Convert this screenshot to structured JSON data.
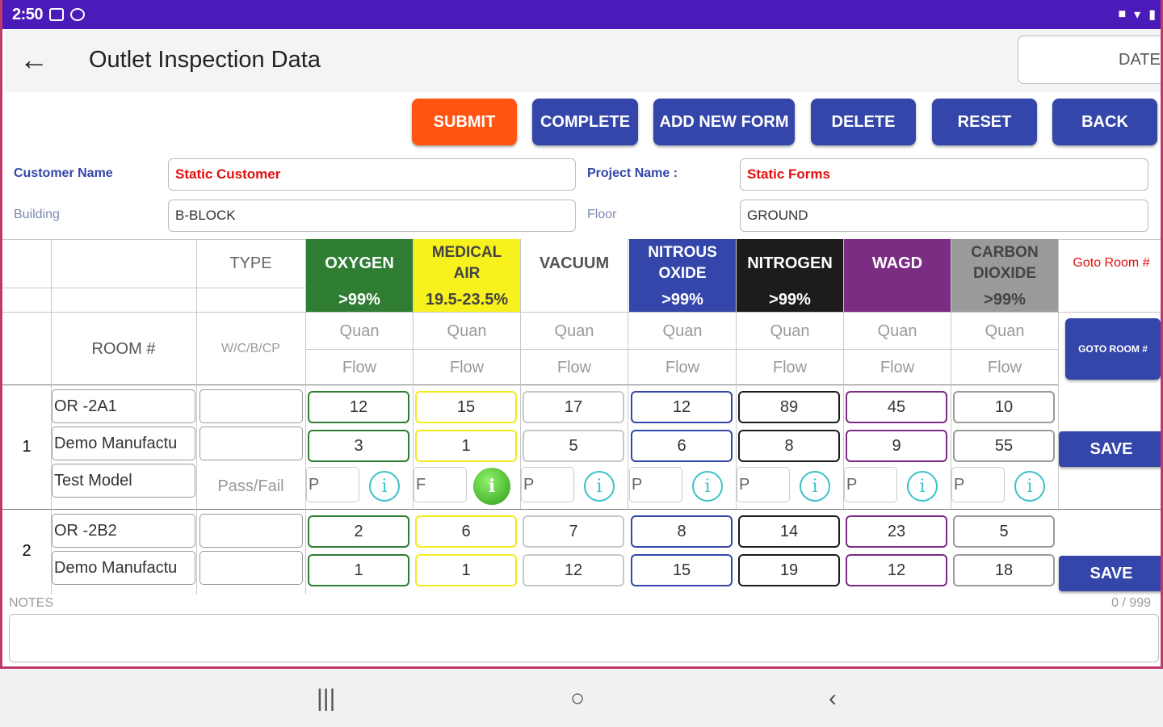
{
  "status": {
    "time": "2:50"
  },
  "appbar": {
    "title": "Outlet Inspection Data",
    "date_placeholder": "DATE"
  },
  "toolbar": {
    "submit": "SUBMIT",
    "complete": "COMPLETE",
    "add_new_form": "ADD NEW FORM",
    "delete": "DELETE",
    "reset": "RESET",
    "back": "BACK"
  },
  "form": {
    "customer_label": "Customer Name",
    "customer_value": "Static Customer",
    "project_label": "Project Name :",
    "project_value": "Static Forms",
    "building_label": "Building",
    "building_value": "B-BLOCK",
    "floor_label": "Floor",
    "floor_value": "GROUND"
  },
  "table": {
    "type_header": "TYPE",
    "room_header": "ROOM #",
    "type_sub": "W/C/B/CP",
    "goto_room_header": "Goto Room #",
    "goto_room_button": "GOTO ROOM #",
    "quan_label": "Quan",
    "flow_label": "Flow",
    "pass_fail_label": "Pass/Fail",
    "save_label": "SAVE",
    "gases": [
      {
        "name": "OXYGEN",
        "spec": ">99%",
        "bg": "#2e7d32",
        "fg": "#ffffff",
        "border": "#2e7d32"
      },
      {
        "name": "MEDICAL AIR",
        "spec": "19.5-23.5%",
        "bg": "#f7f21e",
        "fg": "#444444",
        "border": "#f2ec1a"
      },
      {
        "name": "VACUUM",
        "spec": "",
        "bg": "#ffffff",
        "fg": "#555555",
        "border": "#c8c8c8"
      },
      {
        "name": "NITROUS OXIDE",
        "spec": ">99%",
        "bg": "#3446a9",
        "fg": "#ffffff",
        "border": "#3446a9"
      },
      {
        "name": "NITROGEN",
        "spec": ">99%",
        "bg": "#1c1c1c",
        "fg": "#ffffff",
        "border": "#1c1c1c"
      },
      {
        "name": "WAGD",
        "spec": "",
        "bg": "#7b2c83",
        "fg": "#ffffff",
        "border": "#7b2c83"
      },
      {
        "name": "CARBON DIOXIDE",
        "spec": ">99%",
        "bg": "#9a9a9a",
        "fg": "#444444",
        "border": "#9a9a9a"
      }
    ],
    "rows": [
      {
        "number": "1",
        "room": "OR -2A1",
        "manufacturer": "Demo Manufactu",
        "model": "Test Model",
        "quan": [
          "12",
          "15",
          "17",
          "12",
          "89",
          "45",
          "10"
        ],
        "flow": [
          "3",
          "1",
          "5",
          "6",
          "8",
          "9",
          "55"
        ],
        "pass_fail": [
          "P",
          "F",
          "P",
          "P",
          "P",
          "P",
          "P"
        ]
      },
      {
        "number": "2",
        "room": "OR -2B2",
        "manufacturer": "Demo Manufactu",
        "quan": [
          "2",
          "6",
          "7",
          "8",
          "14",
          "23",
          "5"
        ],
        "flow": [
          "1",
          "1",
          "12",
          "15",
          "19",
          "12",
          "18"
        ]
      }
    ]
  },
  "notes": {
    "label": "NOTES",
    "counter": "0 / 999"
  }
}
